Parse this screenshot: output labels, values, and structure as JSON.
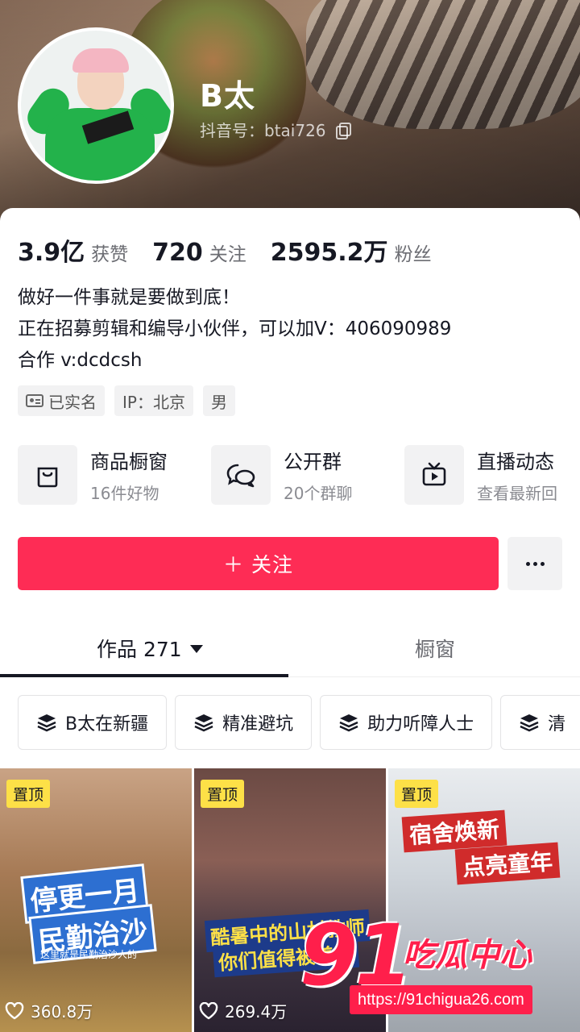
{
  "profile": {
    "name": "B太",
    "douyin_id": "抖音号：btai726"
  },
  "stats": [
    {
      "num": "3.9亿",
      "label": "获赞"
    },
    {
      "num": "720",
      "label": "关注"
    },
    {
      "num": "2595.2万",
      "label": "粉丝"
    }
  ],
  "bio": [
    "做好一件事就是要做到底！",
    "正在招募剪辑和编导小伙伴，可以加V：406090989",
    "合作 v:dcdcsh"
  ],
  "tags": {
    "verified": "已实名",
    "ip": "IP：北京",
    "gender": "男"
  },
  "features": [
    {
      "title": "商品橱窗",
      "sub": "16件好物",
      "icon": "shopping-bag-icon"
    },
    {
      "title": "公开群",
      "sub": "20个群聊",
      "icon": "chat-bubbles-icon"
    },
    {
      "title": "直播动态",
      "sub": "查看最新回",
      "icon": "tv-icon"
    }
  ],
  "actions": {
    "follow": "＋ 关注"
  },
  "tabs": {
    "works": "作品 271",
    "shop": "橱窗"
  },
  "chips": [
    "B太在新疆",
    "精准避坑",
    "助力听障人士",
    "清"
  ],
  "videos": [
    {
      "pin": "置顶",
      "cover_lines": [
        "停更一月",
        "民勤治沙",
        "这里就是民勤治沙人的"
      ],
      "likes": "360.8万"
    },
    {
      "pin": "置顶",
      "cover_lines": [
        "酷暑中的山村教师",
        "你们值得被善待"
      ],
      "likes": "269.4万"
    },
    {
      "pin": "置顶",
      "cover_lines": [
        "宿舍焕新",
        "点亮童年"
      ],
      "likes": ""
    }
  ],
  "watermark": {
    "logo": "91",
    "text": "吃瓜中心",
    "url": "https://91chigua26.com"
  },
  "colors": {
    "accent": "#fe2c55",
    "pin": "#fde047"
  }
}
